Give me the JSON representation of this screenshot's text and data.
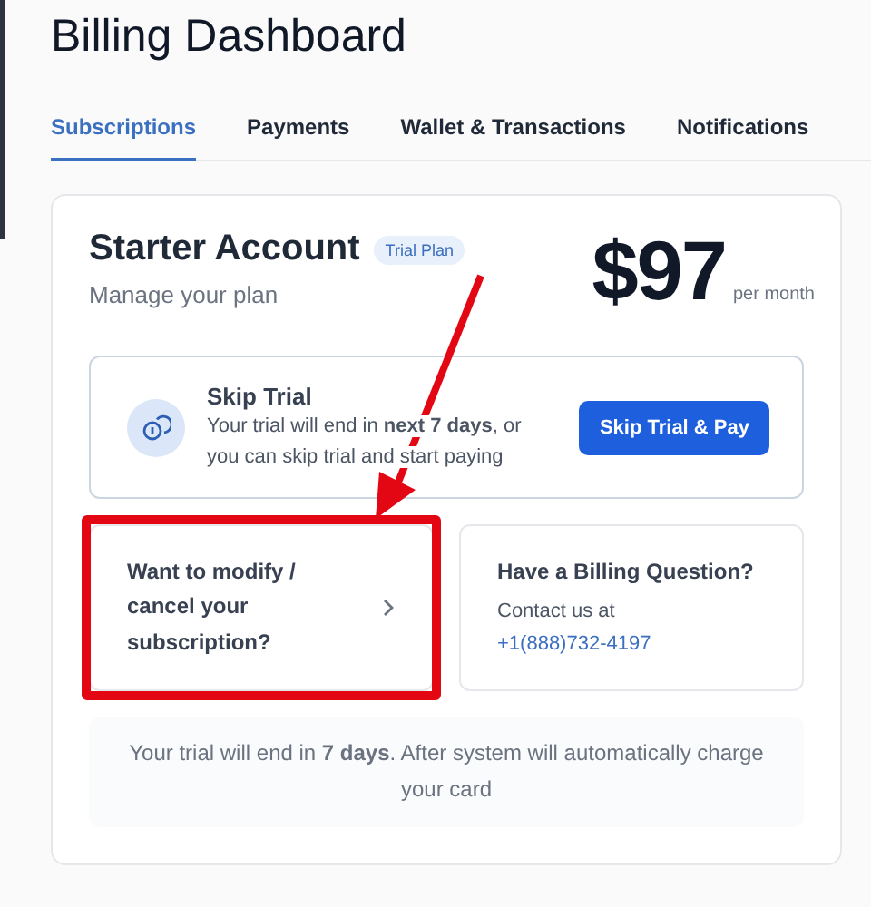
{
  "title": "Billing Dashboard",
  "tabs": [
    {
      "label": "Subscriptions",
      "selected": true
    },
    {
      "label": "Payments",
      "selected": false
    },
    {
      "label": "Wallet & Transactions",
      "selected": false
    },
    {
      "label": "Notifications",
      "selected": false
    }
  ],
  "plan": {
    "name": "Starter Account",
    "badge": "Trial Plan",
    "subtitle": "Manage your plan",
    "price": "$97",
    "period": "per month"
  },
  "skip_trial": {
    "title": "Skip Trial",
    "text": "Your trial will end in **next 7 days**, or you can skip trial and start paying",
    "button": "Skip Trial & Pay"
  },
  "options": [
    {
      "kind": "action",
      "title": "Want to modify / cancel your subscription?",
      "highlighted": true
    },
    {
      "kind": "contact",
      "title": "Have a Billing Question?",
      "text": "Contact us at",
      "link": "+1(888)732-4197",
      "highlighted": false
    }
  ],
  "note": "Your trial will end in **7 days**. After system will automatically charge your card"
}
